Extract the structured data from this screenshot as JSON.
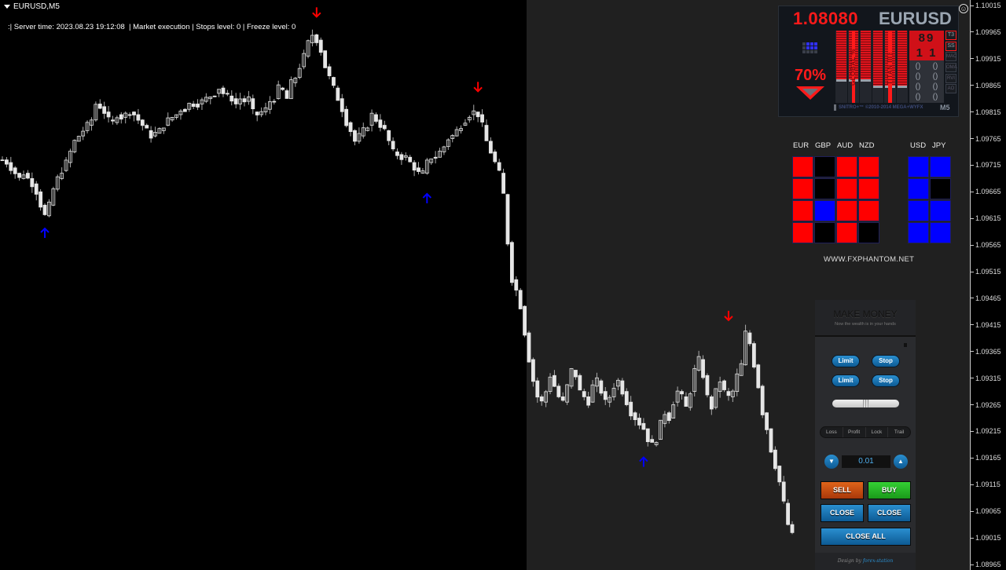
{
  "chart": {
    "symbol_title": "EURUSD,M5",
    "status_line": ":| Server time: 2023.08.23 19:12:08  | Market execution | Stops level: 0 | Freeze level: 0",
    "price_axis": [
      "1.10015",
      "1.09965",
      "1.09915",
      "1.09865",
      "1.09815",
      "1.09765",
      "1.09715",
      "1.09665",
      "1.09615",
      "1.09565",
      "1.09515",
      "1.09465",
      "1.09415",
      "1.09365",
      "1.09315",
      "1.09265",
      "1.09215",
      "1.09165",
      "1.09115",
      "1.09065",
      "1.09015",
      "1.08965"
    ],
    "price_range": [
      1.08965,
      1.10015
    ],
    "colors": {
      "background": "#000000",
      "shaded_zone": "#202020",
      "candle": "#e6e6e6",
      "sell_arrow": "#ff0000",
      "buy_arrow": "#0000ff"
    },
    "signals": [
      {
        "type": "buy",
        "bar": 10,
        "price": 1.09605
      },
      {
        "type": "sell",
        "bar": 74,
        "price": 1.09985
      },
      {
        "type": "buy",
        "bar": 100,
        "price": 1.0967
      },
      {
        "type": "sell",
        "bar": 112,
        "price": 1.09845
      },
      {
        "type": "buy",
        "bar": 151,
        "price": 1.09175
      },
      {
        "type": "sell",
        "bar": 171,
        "price": 1.09415
      }
    ],
    "path": [
      1.09725,
      1.0972,
      1.0971,
      1.097,
      1.0969,
      1.097,
      1.0969,
      1.0968,
      1.09665,
      1.0964,
      1.0962,
      1.0964,
      1.0967,
      1.0969,
      1.09705,
      1.0972,
      1.0974,
      1.0976,
      1.0977,
      1.0978,
      1.0979,
      1.098,
      1.0983,
      1.09825,
      1.09815,
      1.098,
      1.09795,
      1.0981,
      1.09805,
      1.0981,
      1.09815,
      1.0981,
      1.098,
      1.0979,
      1.0978,
      1.0977,
      1.09775,
      1.0978,
      1.0979,
      1.098,
      1.09805,
      1.0981,
      1.0982,
      1.0982,
      1.0983,
      1.0983,
      1.0983,
      1.09835,
      1.0984,
      1.09845,
      1.0985,
      1.0986,
      1.0985,
      1.09845,
      1.0984,
      1.0983,
      1.0984,
      1.09835,
      1.0984,
      1.09815,
      1.0981,
      1.09815,
      1.0982,
      1.09835,
      1.0984,
      1.0986,
      1.09855,
      1.0984,
      1.0987,
      1.0988,
      1.099,
      1.0992,
      1.09945,
      1.0996,
      1.0995,
      1.0993,
      1.099,
      1.0988,
      1.0986,
      1.0984,
      1.0982,
      1.09795,
      1.0978,
      1.0976,
      1.0977,
      1.0978,
      1.0979,
      1.0981,
      1.098,
      1.0979,
      1.0978,
      1.0976,
      1.0974,
      1.09735,
      1.0973,
      1.0973,
      1.0972,
      1.0971,
      1.097,
      1.097,
      1.0972,
      1.0973,
      1.0973,
      1.0974,
      1.0975,
      1.09765,
      1.0977,
      1.0978,
      1.0979,
      1.098,
      1.0981,
      1.09815,
      1.0981,
      1.0979,
      1.0976,
      1.0974,
      1.0972,
      1.097,
      1.0966,
      1.0957,
      1.095,
      1.0948,
      1.0945,
      1.094,
      1.0935,
      1.0931,
      1.0928,
      1.0927,
      1.0929,
      1.0932,
      1.093,
      1.0928,
      1.0927,
      1.093,
      1.0933,
      1.0932,
      1.0929,
      1.0928,
      1.0927,
      1.093,
      1.0931,
      1.0929,
      1.0927,
      1.0928,
      1.093,
      1.0931,
      1.0929,
      1.0927,
      1.0925,
      1.0924,
      1.0923,
      1.0922,
      1.092,
      1.0919,
      1.092,
      1.0923,
      1.0925,
      1.0924,
      1.0927,
      1.0929,
      1.0928,
      1.0926,
      1.0929,
      1.0933,
      1.0935,
      1.0932,
      1.0928,
      1.0926,
      1.0929,
      1.0931,
      1.0929,
      1.0928,
      1.0929,
      1.0932,
      1.0934,
      1.094,
      1.0938,
      1.0934,
      1.093,
      1.0925,
      1.0922,
      1.0918,
      1.0915,
      1.0912,
      1.0908,
      1.0904,
      1.0902
    ]
  },
  "titan_panel": {
    "price": "1.08080",
    "pair": "EURUSD",
    "percent": "70%",
    "direction": "down",
    "bars": [
      {
        "fill_fraction": 0.67,
        "label": ""
      },
      {
        "fill_fraction": 0.67,
        "label": "GLOBAL %"
      },
      {
        "fill_fraction": 0.67,
        "label": ""
      },
      {
        "fill_fraction": 0.76,
        "label": ""
      },
      {
        "fill_fraction": 0.76,
        "label": "TITAN III™"
      },
      {
        "fill_fraction": 0.76,
        "label": ""
      }
    ],
    "score_top": "89",
    "score_bottom": "1 1",
    "signal_glyph": "()",
    "indicators": [
      "T3",
      "SS",
      "MAC",
      "OMA",
      "RVI",
      "AO"
    ],
    "copyright": "SNITRO+™ ©2010-2014 MEGA+WYFX",
    "timeframe": "M5"
  },
  "strength_panel": {
    "left_headers": [
      "EUR",
      "GBP",
      "AUD",
      "NZD"
    ],
    "right_headers": [
      "USD",
      "JPY"
    ],
    "left_grid": [
      [
        "r",
        "k",
        "r",
        "r"
      ],
      [
        "r",
        "k",
        "r",
        "r"
      ],
      [
        "r",
        "b",
        "r",
        "r"
      ],
      [
        "r",
        "k",
        "r",
        "k"
      ]
    ],
    "right_grid": [
      [
        "b",
        "b"
      ],
      [
        "b",
        "k"
      ],
      [
        "b",
        "b"
      ],
      [
        "b",
        "b"
      ]
    ],
    "url": "WWW.FXPHANTOM.NET",
    "colors": {
      "r": "#ff0000",
      "b": "#0000ff",
      "k": "#000000"
    }
  },
  "trade_panel": {
    "title": "MAKE MONEY",
    "subtitle": "Now the wealth is in your hands",
    "limit_label": "Limit",
    "stop_label": "Stop",
    "slider_value": 0.5,
    "modes": [
      "Loss",
      "Profit",
      "Lock",
      "Trail"
    ],
    "lot_value": "0.01",
    "down_glyph": "▼",
    "up_glyph": "▲",
    "sell_label": "SELL",
    "buy_label": "BUY",
    "close_label": "CLOSE",
    "close_all_label": "CLOSE ALL",
    "footer_prefix": "Design by ",
    "footer_author": "forex-station"
  },
  "smiley_glyph": "☺"
}
